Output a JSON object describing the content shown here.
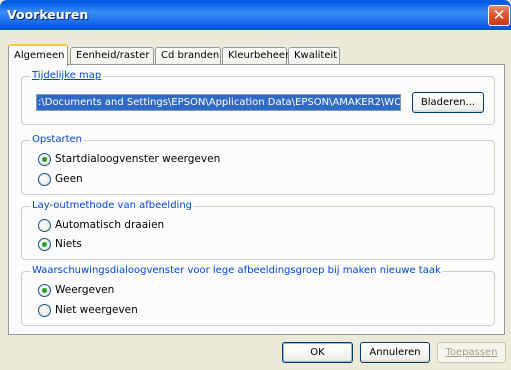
{
  "window": {
    "title": "Voorkeuren",
    "close": "✕"
  },
  "tabs": [
    "Algemeen",
    "Eenheid/raster",
    "Cd branden",
    "Kleurbeheer",
    "Kwaliteit"
  ],
  "temp_folder": {
    "legend": "Tijdelijke map",
    "path": ":\\Documents and Settings\\EPSON\\Application Data\\EPSON\\AMAKER2\\WORK",
    "browse": "Bladeren..."
  },
  "startup": {
    "legend": "Opstarten",
    "options": [
      "Startdialoogvenster weergeven",
      "Geen"
    ],
    "selected": 0
  },
  "layout": {
    "legend": "Lay-outmethode van afbeelding",
    "options": [
      "Automatisch draaien",
      "Niets"
    ],
    "selected": 1
  },
  "warning": {
    "legend": "Waarschuwingsdialoogvenster voor lege afbeeldingsgroep bij maken nieuwe taak",
    "options": [
      "Weergeven",
      "Niet weergeven"
    ],
    "selected": 0
  },
  "buttons": {
    "ok": "OK",
    "cancel": "Annuleren",
    "apply": "Toepassen"
  }
}
